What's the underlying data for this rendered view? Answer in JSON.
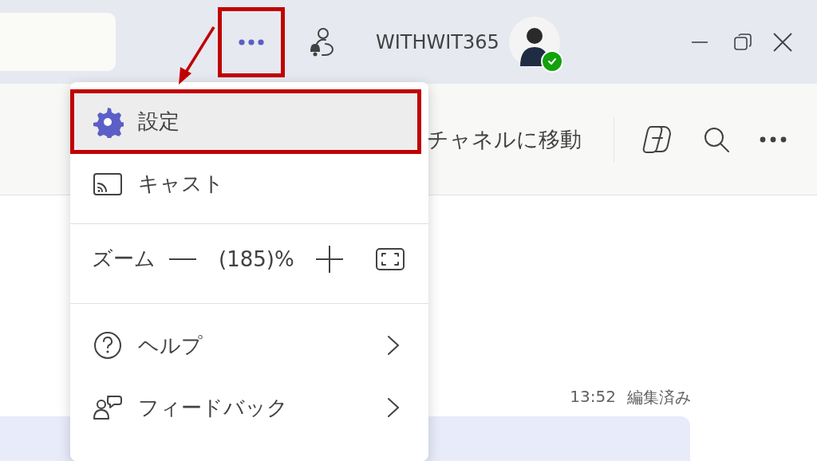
{
  "title_bar": {
    "more_button": {
      "highlighted": true
    },
    "user": {
      "name": "WITHWIT365",
      "online": true
    }
  },
  "channel_header": {
    "link": "チャネルに移動"
  },
  "message": {
    "time": "13:52",
    "edited": "編集済み"
  },
  "menu": {
    "items": [
      {
        "kind": "item",
        "label": "設定",
        "selected": true,
        "highlighted": true,
        "submenu": false
      },
      {
        "kind": "item",
        "label": "キャスト",
        "selected": false,
        "highlighted": false,
        "submenu": false
      },
      {
        "kind": "separator"
      },
      {
        "kind": "zoom",
        "label": "ズーム",
        "value": "(185)%"
      },
      {
        "kind": "separator"
      },
      {
        "kind": "item",
        "label": "ヘルプ",
        "selected": false,
        "highlighted": false,
        "submenu": true
      },
      {
        "kind": "item",
        "label": "フィードバック",
        "selected": false,
        "highlighted": false,
        "submenu": true
      }
    ]
  }
}
